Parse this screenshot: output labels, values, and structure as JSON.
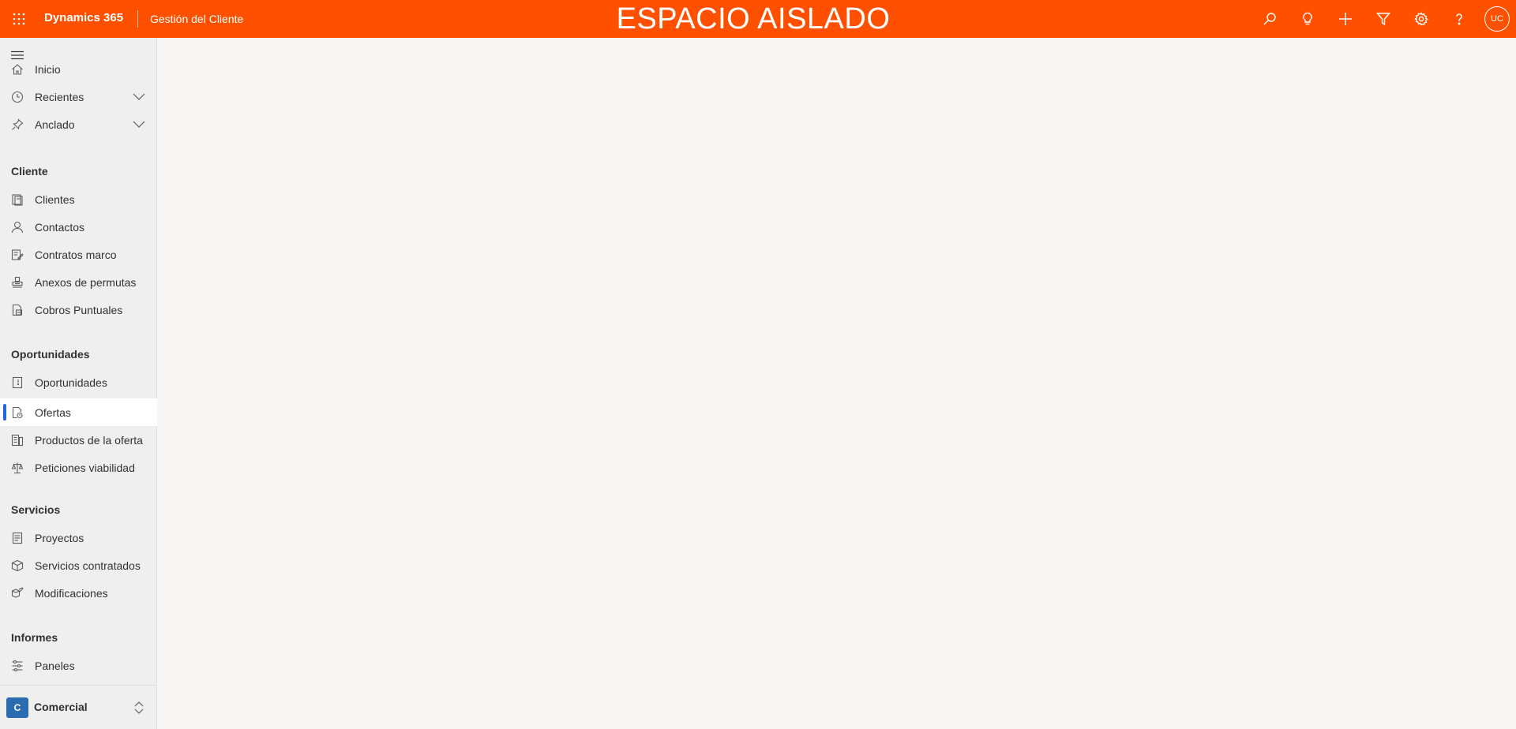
{
  "header": {
    "brand": "Dynamics 365",
    "app_name": "Gestión del Cliente",
    "environment_banner": "ESPACIO AISLADO",
    "user_initials": "UC",
    "icons": [
      "waffle-icon",
      "search-icon",
      "lightbulb-icon",
      "plus-icon",
      "filter-icon",
      "gear-icon",
      "help-icon"
    ]
  },
  "sidebar": {
    "top_items": [
      {
        "label": "Inicio",
        "icon": "home-icon"
      },
      {
        "label": "Recientes",
        "icon": "clock-icon"
      },
      {
        "label": "Anclado",
        "icon": "pin-icon"
      }
    ],
    "groups": [
      {
        "title": "Cliente",
        "items": [
          "Clientes",
          "Contactos",
          "Contratos marco",
          "Anexos de permutas",
          "Cobros Puntuales"
        ]
      },
      {
        "title": "Oportunidades",
        "items": [
          "Oportunidades",
          "Ofertas",
          "Productos de la oferta",
          "Peticiones viabilidad"
        ]
      },
      {
        "title": "Servicios",
        "items": [
          "Proyectos",
          "Servicios contratados",
          "Modificaciones"
        ]
      },
      {
        "title": "Informes",
        "items": [
          "Paneles"
        ]
      }
    ],
    "selected_item": "Ofertas",
    "area": {
      "badge": "C",
      "label": "Comercial"
    }
  },
  "colors": {
    "header_bg": "#ff5000",
    "selected_accent": "#2266e3",
    "area_badge": "#2b6cb0"
  }
}
